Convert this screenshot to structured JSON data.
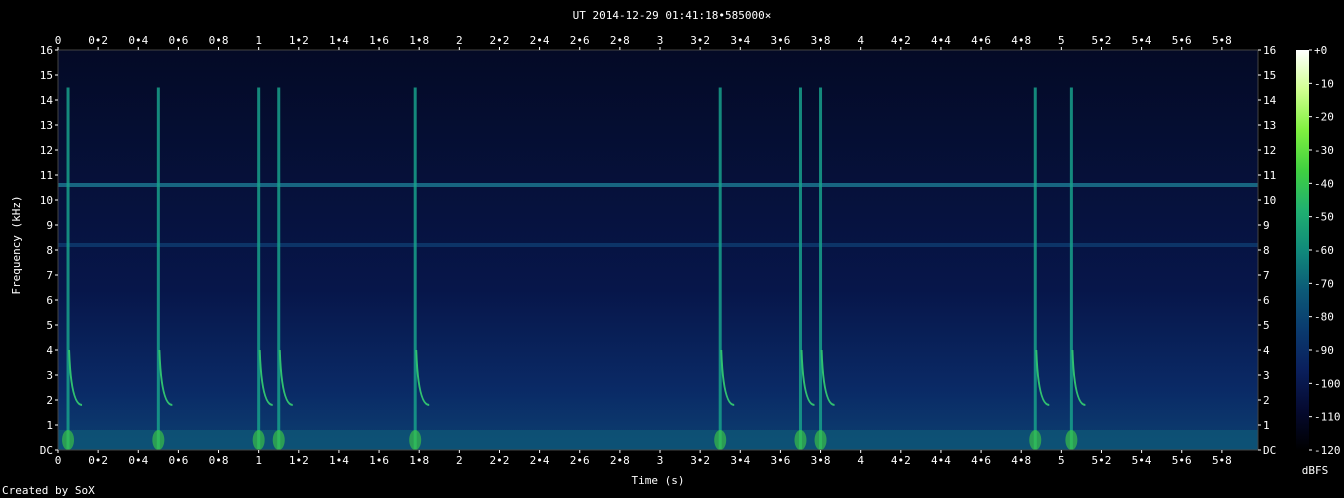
{
  "chart_data": {
    "type": "heatmap",
    "title": "UT 2014-12-29 01:41:18•585000×",
    "xlabel": "Time (s)",
    "ylabel": "Frequency (kHz)",
    "xlim": [
      0,
      5.98
    ],
    "ylim": [
      0,
      16
    ],
    "x_ticks": [
      "0",
      "0•2",
      "0•4",
      "0•6",
      "0•8",
      "1",
      "1•2",
      "1•4",
      "1•6",
      "1•8",
      "2",
      "2•2",
      "2•4",
      "2•6",
      "2•8",
      "3",
      "3•2",
      "3•4",
      "3•6",
      "3•8",
      "4",
      "4•2",
      "4•4",
      "4•6",
      "4•8",
      "5",
      "5•2",
      "5•4",
      "5•6",
      "5•8"
    ],
    "y_ticks": [
      "DC",
      "1",
      "2",
      "3",
      "4",
      "5",
      "6",
      "7",
      "8",
      "9",
      "10",
      "11",
      "12",
      "13",
      "14",
      "15",
      "16"
    ],
    "colorbar": {
      "label": "dBFS",
      "ticks": [
        "+0",
        "-10",
        "-20",
        "-30",
        "-40",
        "-50",
        "-60",
        "-70",
        "-80",
        "-90",
        "-100",
        "-110",
        "-120"
      ],
      "range": [
        -120,
        0
      ],
      "colors": [
        "#000000",
        "#050a30",
        "#0a1f5c",
        "#0a3a6e",
        "#0c5a78",
        "#108a7a",
        "#20b070",
        "#40d040",
        "#80f040",
        "#d0ff90",
        "#ffffff"
      ]
    },
    "features": {
      "steady_tone_khz": [
        10.6,
        8.2
      ],
      "transients_s": [
        0.05,
        0.5,
        1.0,
        1.1,
        1.78,
        3.3,
        3.7,
        3.8,
        4.87,
        5.05
      ],
      "decay_to_khz": 1.8
    }
  },
  "footer": {
    "credit": "Created by SoX"
  }
}
